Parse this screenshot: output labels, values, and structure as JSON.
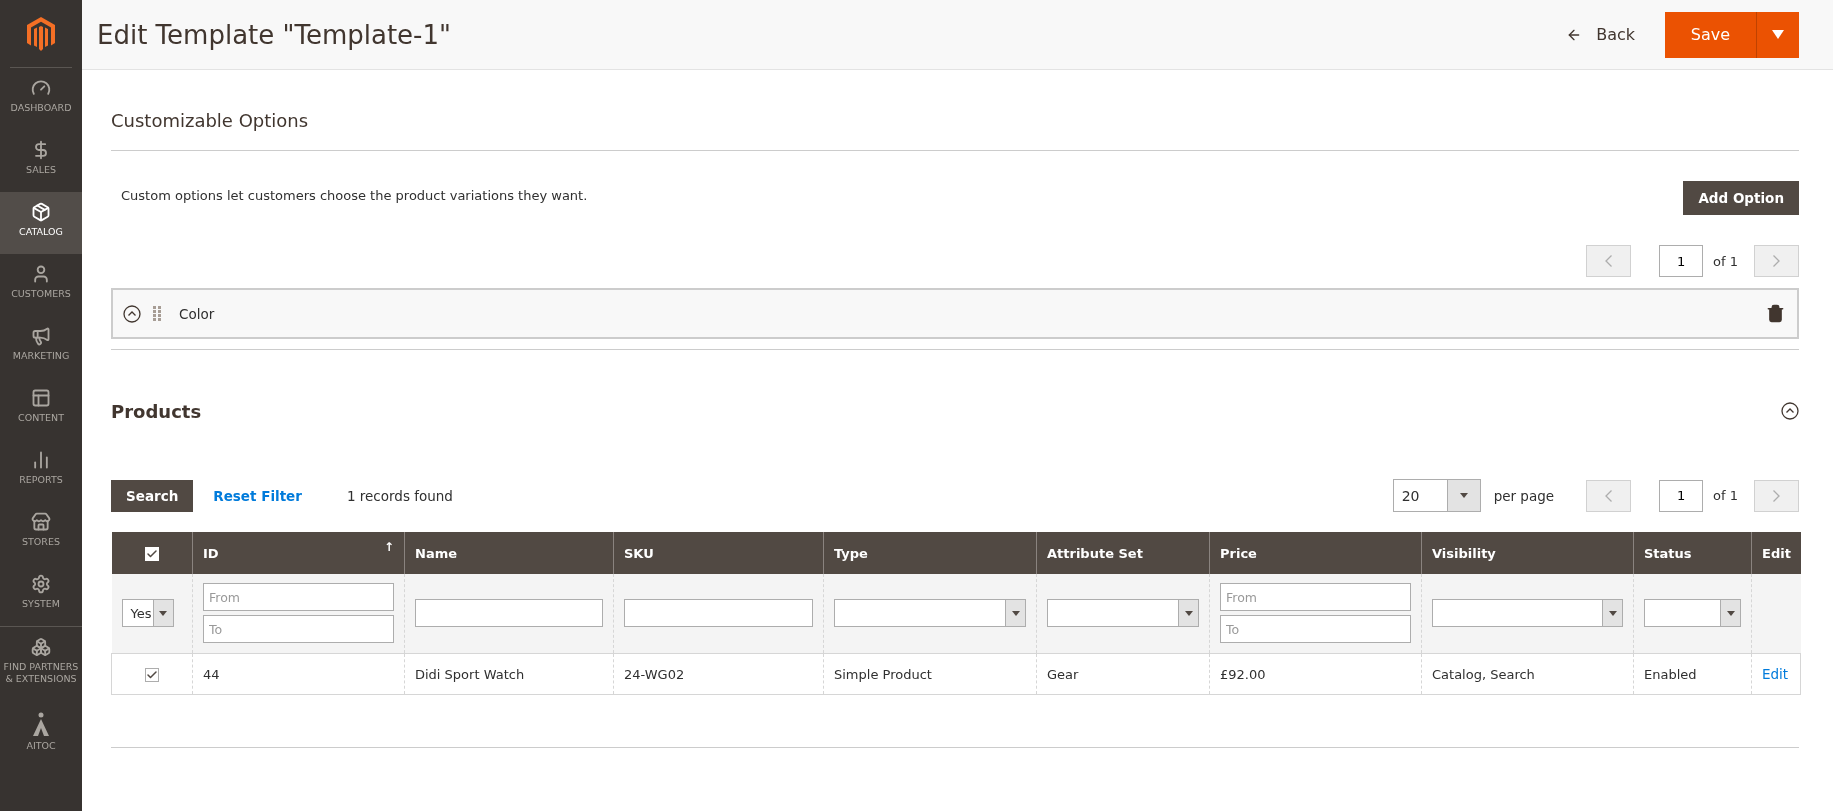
{
  "sidebar": {
    "items": [
      {
        "label": "DASHBOARD",
        "selected": false
      },
      {
        "label": "SALES",
        "selected": false
      },
      {
        "label": "CATALOG",
        "selected": true
      },
      {
        "label": "CUSTOMERS",
        "selected": false
      },
      {
        "label": "MARKETING",
        "selected": false
      },
      {
        "label": "CONTENT",
        "selected": false
      },
      {
        "label": "REPORTS",
        "selected": false
      },
      {
        "label": "STORES",
        "selected": false
      },
      {
        "label": "SYSTEM",
        "selected": false
      },
      {
        "label": "FIND PARTNERS & EXTENSIONS",
        "selected": false
      },
      {
        "label": "AITOC",
        "selected": false
      }
    ]
  },
  "header": {
    "title": "Edit Template \"Template-1\"",
    "back": "Back",
    "save": "Save"
  },
  "options_section": {
    "title": "Customizable Options",
    "description": "Custom options let customers choose the product variations they want.",
    "add_button": "Add Option",
    "pager": {
      "page": "1",
      "of": "of 1"
    },
    "options": [
      {
        "title": "Color",
        "expanded": true
      }
    ]
  },
  "products": {
    "title": "Products",
    "expanded": true,
    "search_button": "Search",
    "reset_link": "Reset Filter",
    "records": "1 records found",
    "per_page": {
      "value": "20",
      "label": "per page"
    },
    "pager": {
      "page": "1",
      "of": "of 1"
    },
    "columns": [
      {
        "kind": "checkbox",
        "checked": true,
        "filter": {
          "kind": "select",
          "value": "Yes"
        }
      },
      {
        "label": "ID",
        "sort_indicator": "↑",
        "filter": {
          "kind": "range",
          "fields": [
            {
              "placeholder": "From"
            },
            {
              "placeholder": "To"
            }
          ]
        }
      },
      {
        "label": "Name",
        "filter": {
          "kind": "text"
        }
      },
      {
        "label": "SKU",
        "filter": {
          "kind": "text"
        }
      },
      {
        "label": "Type",
        "filter": {
          "kind": "select"
        }
      },
      {
        "label": "Attribute Set",
        "filter": {
          "kind": "select"
        }
      },
      {
        "label": "Price",
        "filter": {
          "kind": "range",
          "fields": [
            {
              "placeholder": "From"
            },
            {
              "placeholder": "To"
            }
          ]
        }
      },
      {
        "label": "Visibility",
        "filter": {
          "kind": "select"
        }
      },
      {
        "label": "Status",
        "filter": {
          "kind": "select"
        }
      },
      {
        "label": "Edit",
        "filter": {
          "kind": "none"
        }
      }
    ],
    "rows": [
      {
        "cells": [
          {
            "kind": "checkbox",
            "checked": true
          },
          {
            "kind": "text",
            "text": "44"
          },
          {
            "kind": "text",
            "text": "Didi Sport Watch"
          },
          {
            "kind": "text",
            "text": "24-WG02"
          },
          {
            "kind": "text",
            "text": "Simple Product"
          },
          {
            "kind": "text",
            "text": "Gear"
          },
          {
            "kind": "text",
            "text": "£92.00"
          },
          {
            "kind": "text",
            "text": "Catalog, Search"
          },
          {
            "kind": "text",
            "text": "Enabled"
          },
          {
            "kind": "link",
            "text": "Edit"
          }
        ]
      }
    ]
  }
}
